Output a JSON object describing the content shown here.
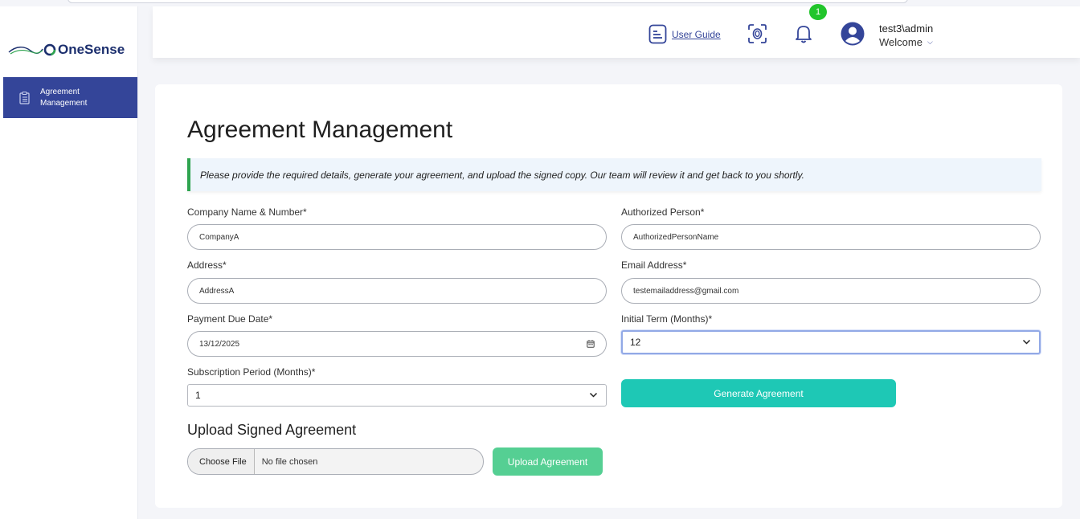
{
  "app": {
    "name": "OneSense"
  },
  "sidebar": {
    "items": [
      {
        "label": "Agreement Management",
        "active": true
      }
    ]
  },
  "header": {
    "user_guide_label": "User Guide",
    "notification_count": "1",
    "username": "test3\\admin",
    "welcome_label": "Welcome"
  },
  "page": {
    "title": "Agreement Management",
    "notice": "Please provide the required details, generate your agreement, and upload the signed copy. Our team will review it and get back to you shortly."
  },
  "form": {
    "company": {
      "label": "Company Name & Number*",
      "value": "CompanyA"
    },
    "authorized": {
      "label": "Authorized Person*",
      "value": "AuthorizedPersonName"
    },
    "address": {
      "label": "Address*",
      "value": "AddressA"
    },
    "email": {
      "label": "Email Address*",
      "value": "testemailaddress@gmail.com"
    },
    "payment_due": {
      "label": "Payment Due Date*",
      "value": "13/12/2025"
    },
    "initial_term": {
      "label": "Initial Term (Months)*",
      "value": "12"
    },
    "subscription": {
      "label": "Subscription Period (Months)*",
      "value": "1"
    },
    "generate_label": "Generate Agreement"
  },
  "upload": {
    "title": "Upload Signed Agreement",
    "choose_label": "Choose File",
    "no_file_label": "No file chosen",
    "upload_label": "Upload Agreement"
  },
  "colors": {
    "brand": "#344599",
    "generate": "#1ec8b5",
    "upload": "#55cf93",
    "notice_border": "#2ea44f",
    "badge": "#21c52b"
  }
}
